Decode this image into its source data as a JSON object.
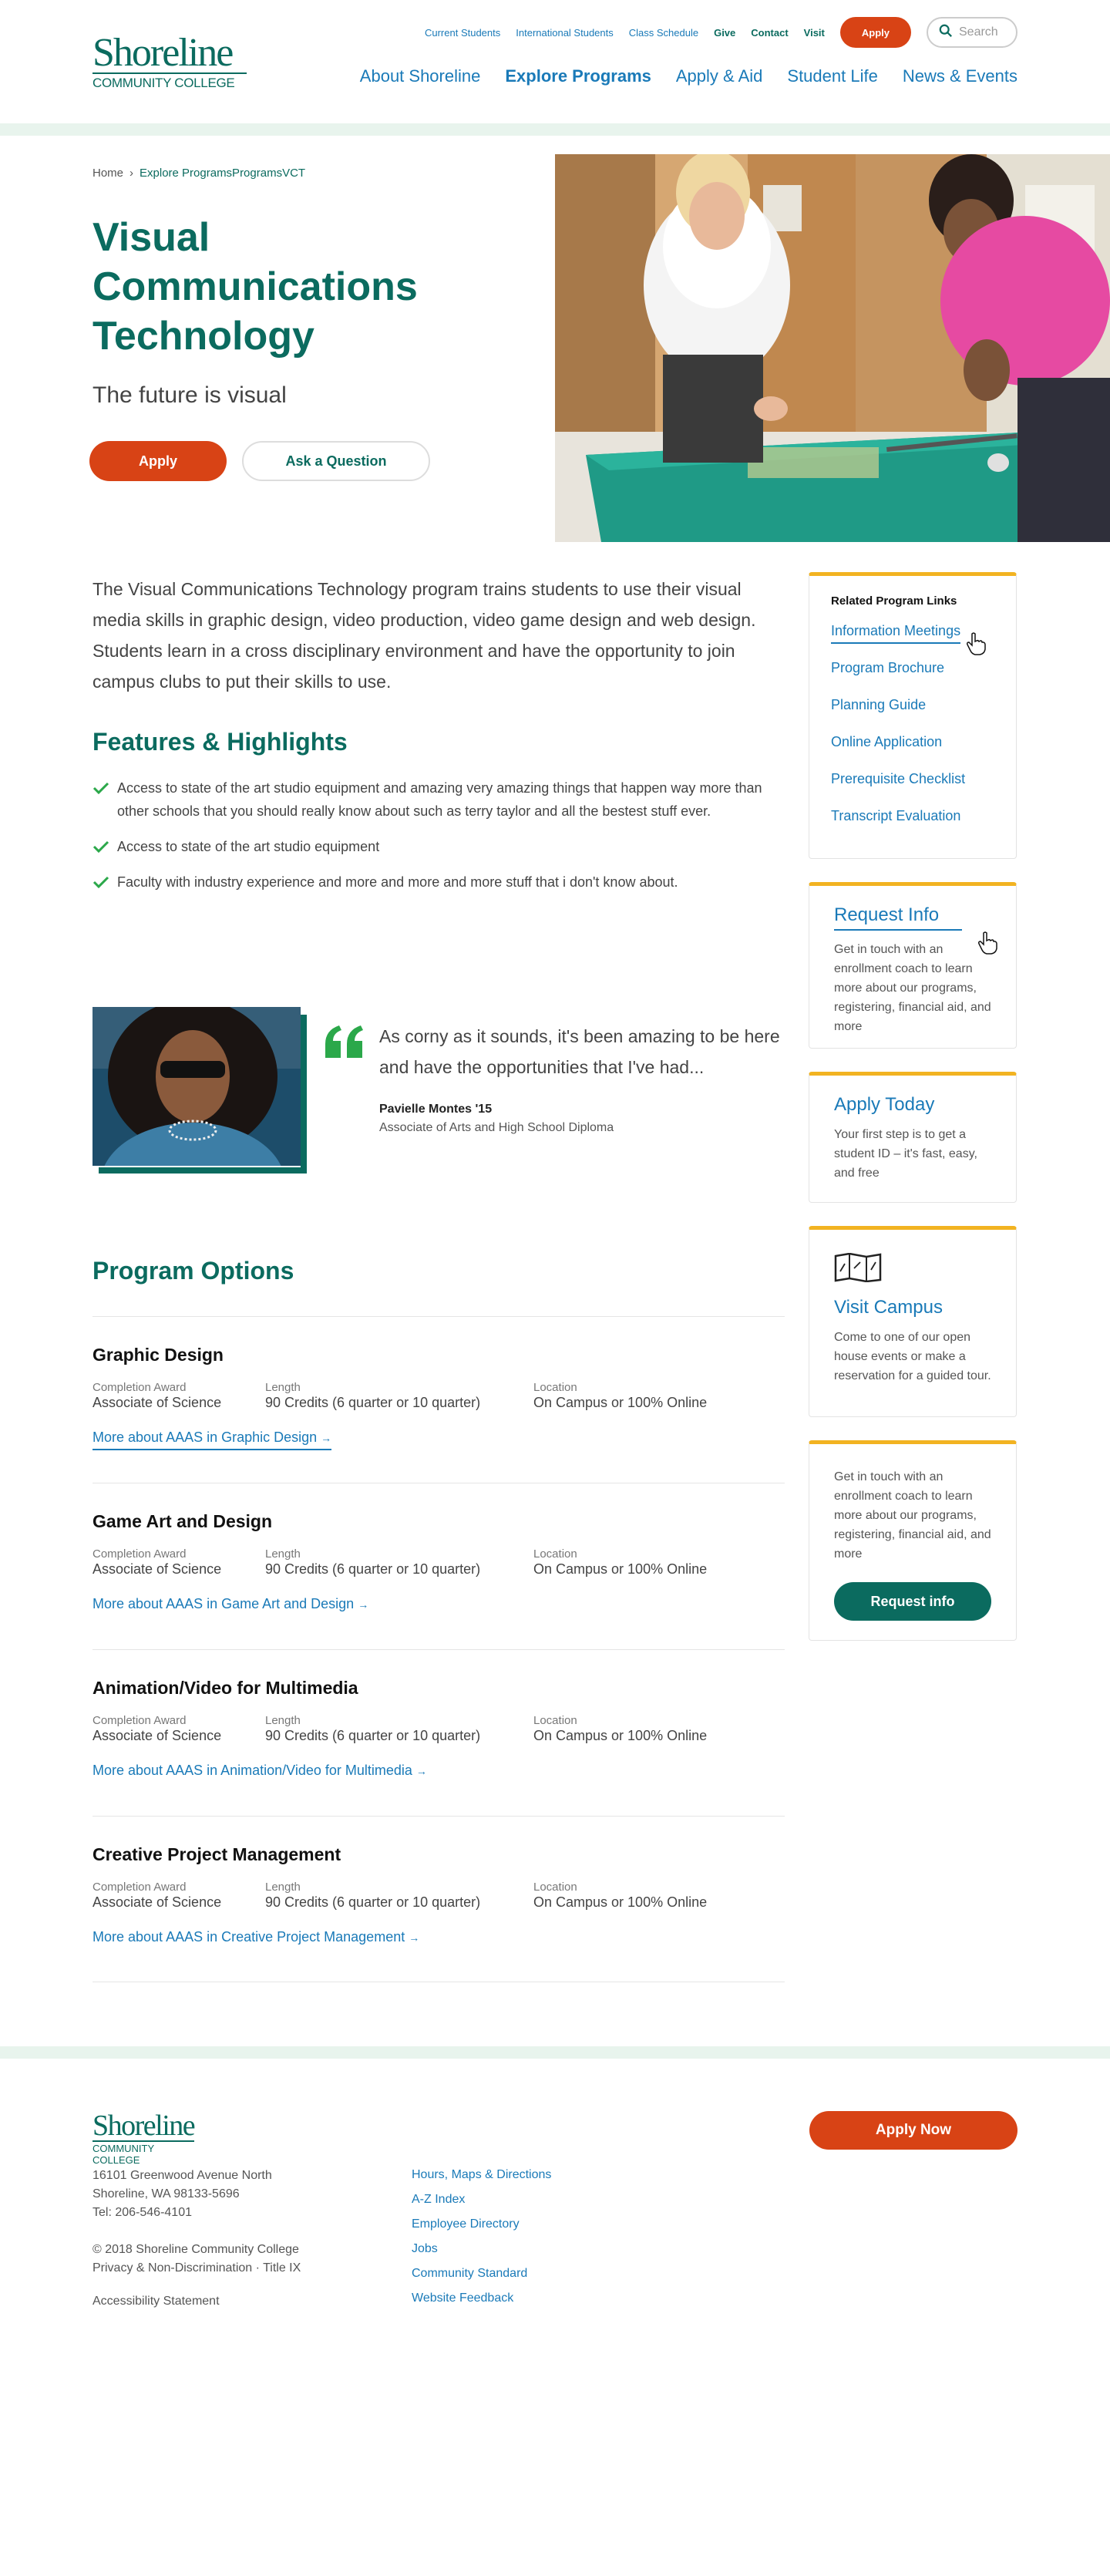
{
  "header": {
    "logo_line1": "Shoreline",
    "logo_line2": "COMMUNITY COLLEGE",
    "utility_links": [
      "Current Students",
      "International Students",
      "Class Schedule"
    ],
    "give": "Give",
    "contact": "Contact",
    "visit": "Visit",
    "apply": "Apply",
    "search_placeholder": "Search",
    "nav": [
      "About Shoreline",
      "Explore Programs",
      "Apply & Aid",
      "Student Life",
      "News & Events"
    ]
  },
  "breadcrumb": {
    "home": "Home",
    "sep": "›",
    "current": "Explore ProgramsProgramsVCT"
  },
  "hero": {
    "title": "Visual Communications Technology",
    "subtitle": "The future is visual",
    "apply_button": "Apply",
    "ask_button": "Ask a Question"
  },
  "intro": "The Visual Communications Technology program trains students to use their visual media skills in graphic design, video production, video game design and web design. Students learn in a cross disciplinary environment and have the opportunity to join campus clubs to put their skills to use.",
  "features": {
    "title": "Features & Highlights",
    "items": [
      "Access to state of the art studio equipment and amazing very amazing things that happen way more than other schools that you should really know about such as terry taylor and all the bestest stuff ever.",
      "Access to state of the art studio equipment",
      "Faculty with industry experience and more and more and more stuff that i don't know about."
    ]
  },
  "testimonial": {
    "quote": "As corny as it sounds, it's been amazing to be here and have the opportunities that I've had...",
    "name": "Pavielle Montes '15",
    "degree": "Associate of Arts and High School Diploma"
  },
  "program_options": {
    "title": "Program Options",
    "labels": {
      "award": "Completion Award",
      "length": "Length",
      "location": "Location"
    },
    "programs": [
      {
        "name": "Graphic Design",
        "award": "Associate of Science",
        "length": "90 Credits (6 quarter or 10 quarter)",
        "location": "On Campus or 100% Online",
        "link": "More about AAAS in Graphic Design"
      },
      {
        "name": "Game Art and Design",
        "award": "Associate of Science",
        "length": "90 Credits (6 quarter or 10 quarter)",
        "location": "On Campus or 100% Online",
        "link": "More about AAAS in Game Art and Design"
      },
      {
        "name": "Animation/Video for Multimedia",
        "award": "Associate of Science",
        "length": "90 Credits (6 quarter or 10 quarter)",
        "location": "On Campus or 100% Online",
        "link": "More about AAAS in Animation/Video for Multimedia"
      },
      {
        "name": "Creative Project Management",
        "award": "Associate of Science",
        "length": "90 Credits (6 quarter or 10 quarter)",
        "location": "On Campus or 100% Online",
        "link": "More about AAAS in Creative Project Management"
      }
    ]
  },
  "sidebar": {
    "related_title": "Related Program Links",
    "related_links": [
      "Information Meetings",
      "Program Brochure",
      "Planning Guide",
      "Online Application",
      "Prerequisite Checklist",
      "Transcript Evaluation"
    ],
    "request_info": {
      "title": "Request Info",
      "text": "Get in touch with an enrollment coach to learn more about our programs, registering, financial aid, and more"
    },
    "apply_today": {
      "title": "Apply Today",
      "text": "Your first step is to get a student ID – it's fast, easy, and free"
    },
    "visit_campus": {
      "title": "Visit Campus",
      "text": "Come to one of our open house events or make a reservation for a guided tour."
    },
    "enroll_card": {
      "text": "Get in touch with an enrollment coach to learn more about our programs, registering, financial aid, and more",
      "button": "Request info"
    }
  },
  "footer": {
    "logo_line1": "Shoreline",
    "logo_line2": "COMMUNITY COLLEGE",
    "address1": "16101 Greenwood Avenue North",
    "address2": "Shoreline, WA 98133-5696",
    "phone": "Tel: 206-546-4101",
    "copyright": "© 2018 Shoreline Community College",
    "policy": "Privacy & Non-Discrimination · Title IX",
    "accessibility": "Accessibility Statement",
    "links": [
      "Hours, Maps & Directions",
      "A-Z Index",
      "Employee Directory",
      "Jobs",
      "Community Standard",
      "Website Feedback"
    ],
    "apply_now": "Apply Now"
  },
  "colors": {
    "brand_green": "#0b6b5f",
    "accent_orange": "#d84315",
    "link_blue": "#1a7ab8",
    "card_top": "#f2b321",
    "band": "#e8f4ed"
  }
}
